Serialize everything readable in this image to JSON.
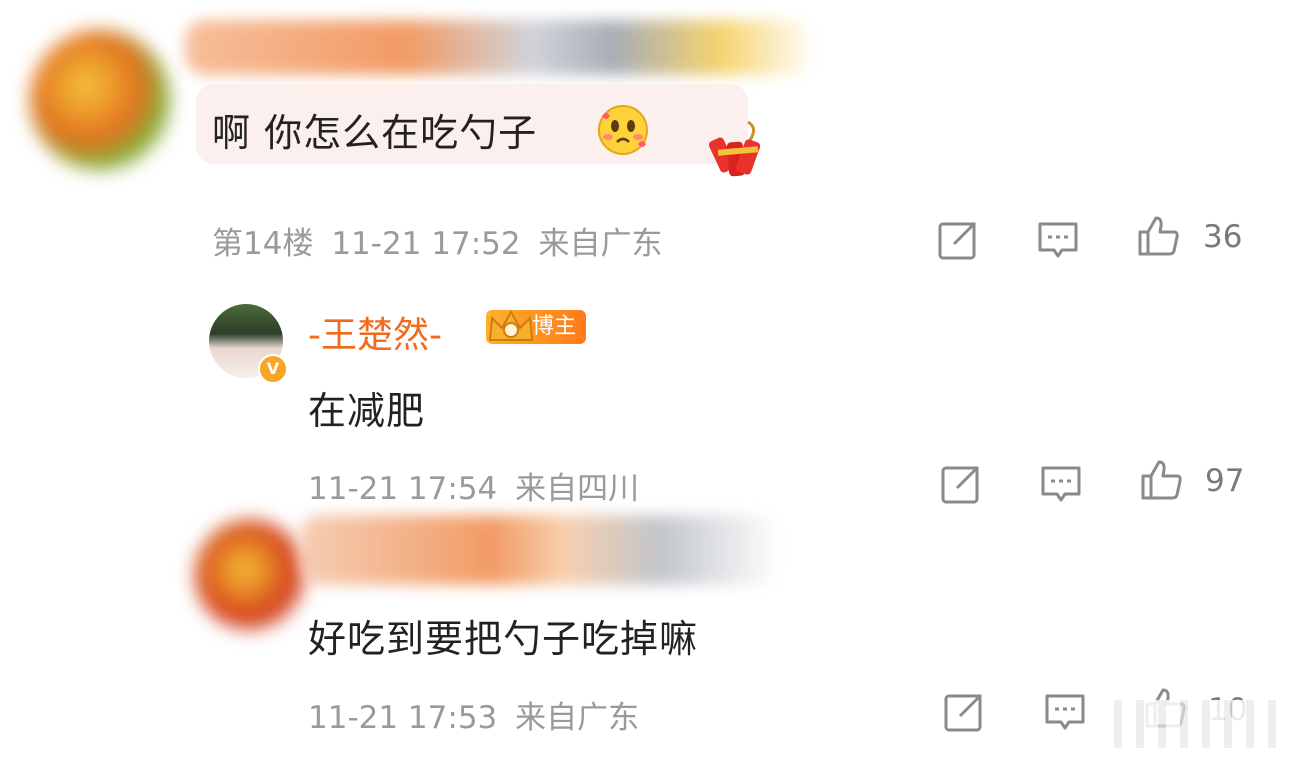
{
  "comments": [
    {
      "text": "啊 你怎么在吃勺子",
      "floor": "第14楼",
      "time": "11-21 17:52",
      "location": "来自广东",
      "likes": "36",
      "emoji": "crying-face-emoji",
      "sticker": "firecracker-icon"
    },
    {
      "name": "-王楚然-",
      "badge": "博主",
      "text": "在减肥",
      "time": "11-21 17:54",
      "location": "来自四川",
      "likes": "97",
      "verified_mark": "V"
    },
    {
      "text": "好吃到要把勺子吃掉嘛",
      "time": "11-21 17:53",
      "location": "来自广东",
      "likes": "10"
    }
  ],
  "colors": {
    "accent": "#f26a1b",
    "bubble": "#fbf0ee",
    "meta": "#9a9a9a",
    "icon": "#8a8a8a"
  },
  "icons": [
    "share-icon",
    "comment-icon",
    "like-icon"
  ]
}
